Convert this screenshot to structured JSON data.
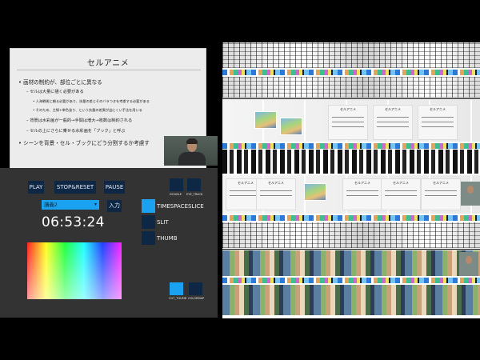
{
  "slide": {
    "title": "セルアニメ",
    "lines": [
      {
        "level": 1,
        "text": "• 画材の制約が、部位ごとに異なる"
      },
      {
        "level": 2,
        "text": "– セルは大量に描く必要がある"
      },
      {
        "level": 3,
        "text": "• 人海戦術に頼る必要があり、技量の差とそのバラつきを考慮する必要がある"
      },
      {
        "level": 3,
        "text": "• そのため、主線+単色塗り、という技量の差異が出にくい手法を用いる"
      },
      {
        "level": 2,
        "text": "– 背景は水彩画が一般的→手間は増大→枚数は制約される"
      },
      {
        "level": 2,
        "text": "– セルの上にさらに乗せる水彩画を「ブック」と呼ぶ"
      },
      {
        "level": 1,
        "text": "• シーンを背景・セル・ブックにどう分割するか考慮す"
      }
    ]
  },
  "controls": {
    "play_label": "PLAY",
    "stop_reset_label": "STOP&RESET",
    "pause_label": "PAUSE",
    "speaker_value": "講義2",
    "input_label": "入力",
    "clock": "06:53:24"
  },
  "view": {
    "toggles_top": [
      {
        "label": "DOUBLE",
        "on": false
      },
      {
        "label": "EYE_TRACK",
        "on": false
      }
    ],
    "modes": [
      {
        "label": "TIMESPACESLICE",
        "on": true
      },
      {
        "label": "SLIT",
        "on": false
      },
      {
        "label": "THUMB",
        "on": false
      }
    ],
    "toggles_bottom": [
      {
        "label": "CUT_THUMB",
        "on": true
      },
      {
        "label": "COLORMAP",
        "on": false
      }
    ]
  },
  "viz_cards": {
    "card_title": "セルアニメ"
  },
  "colors": {
    "panel_bg": "#333333",
    "button_bg": "#0e2744",
    "accent": "#1aa1f0",
    "slide_bg": "#ececec"
  }
}
